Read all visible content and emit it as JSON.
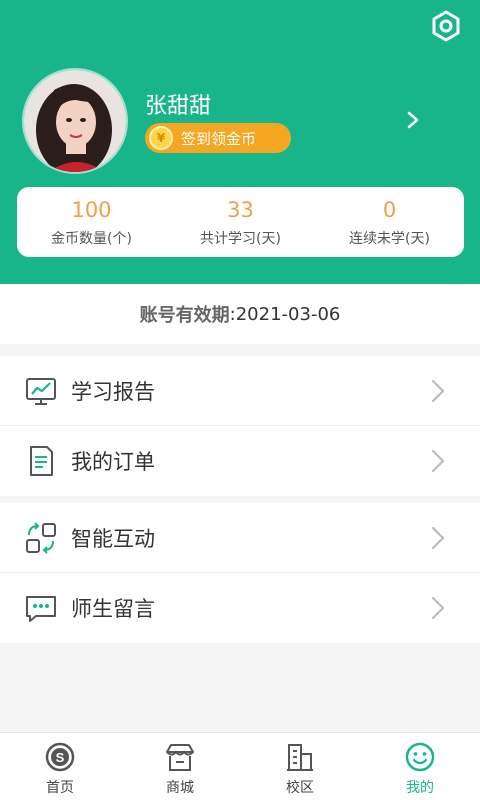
{
  "profile": {
    "username": "张甜甜",
    "coin_button_label": "签到领金币"
  },
  "stats": [
    {
      "value": "100",
      "label": "金币数量(个)"
    },
    {
      "value": "33",
      "label": "共计学习(天)"
    },
    {
      "value": "0",
      "label": "连续未学(天)"
    }
  ],
  "validity": {
    "label": "账号有效期",
    "separator": ":",
    "value": " 2021-03-06"
  },
  "menu": [
    {
      "label": "学习报告",
      "icon": "report-icon"
    },
    {
      "label": "我的订单",
      "icon": "order-icon"
    },
    {
      "label": "智能互动",
      "icon": "interaction-icon"
    },
    {
      "label": "师生留言",
      "icon": "message-icon"
    }
  ],
  "tabbar": [
    {
      "label": "首页",
      "icon": "home-icon"
    },
    {
      "label": "商城",
      "icon": "shop-icon"
    },
    {
      "label": "校区",
      "icon": "campus-icon"
    },
    {
      "label": "我的",
      "icon": "profile-icon",
      "active": true
    }
  ],
  "colors": {
    "brand": "#19b58a",
    "coin": "#f5a623",
    "stat_value": "#f0a04b"
  }
}
